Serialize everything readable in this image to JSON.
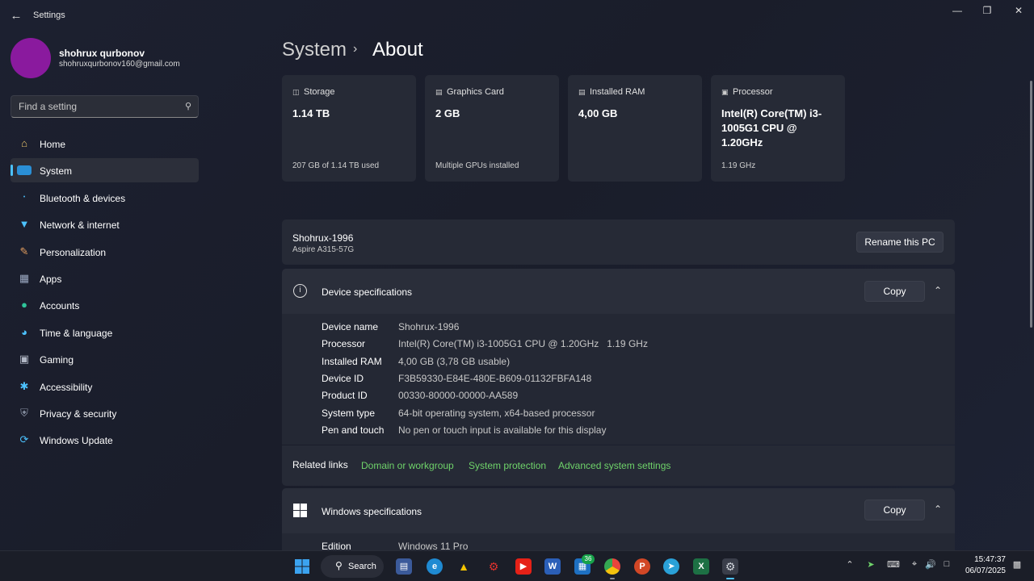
{
  "window": {
    "title": "Settings",
    "minimize": "—",
    "maximize": "❐",
    "close": "✕"
  },
  "user": {
    "name": "shohrux qurbonov",
    "email": "shohruxqurbonov160@gmail.com"
  },
  "search": {
    "placeholder": "Find a setting"
  },
  "nav": [
    {
      "label": "Home",
      "icon": "home-icon",
      "active": false
    },
    {
      "label": "System",
      "icon": "system-icon",
      "active": true
    },
    {
      "label": "Bluetooth & devices",
      "icon": "bluetooth-icon",
      "active": false
    },
    {
      "label": "Network & internet",
      "icon": "wifi-icon",
      "active": false
    },
    {
      "label": "Personalization",
      "icon": "brush-icon",
      "active": false
    },
    {
      "label": "Apps",
      "icon": "apps-icon",
      "active": false
    },
    {
      "label": "Accounts",
      "icon": "accounts-icon",
      "active": false
    },
    {
      "label": "Time & language",
      "icon": "globe-icon",
      "active": false
    },
    {
      "label": "Gaming",
      "icon": "gamepad-icon",
      "active": false
    },
    {
      "label": "Accessibility",
      "icon": "accessibility-icon",
      "active": false
    },
    {
      "label": "Privacy & security",
      "icon": "shield-icon",
      "active": false
    },
    {
      "label": "Windows Update",
      "icon": "update-icon",
      "active": false
    }
  ],
  "breadcrumb": {
    "parent": "System",
    "separator": "›",
    "current": "About"
  },
  "cards": [
    {
      "title": "Storage",
      "value": "1.14 TB",
      "sub": "207 GB of 1.14 TB used",
      "icon": "storage-icon"
    },
    {
      "title": "Graphics Card",
      "value": "2 GB",
      "sub": "Multiple GPUs installed",
      "icon": "gpu-icon"
    },
    {
      "title": "Installed RAM",
      "value": "4,00 GB",
      "sub": "",
      "icon": "ram-icon"
    },
    {
      "title": "Processor",
      "value": "Intel(R) Core(TM) i3-1005G1 CPU @ 1.20GHz",
      "sub": "1.19 GHz",
      "icon": "cpu-icon"
    }
  ],
  "pc": {
    "name": "Shohrux-1996",
    "model": "Aspire A315-57G",
    "rename_label": "Rename this PC"
  },
  "device_specs": {
    "title": "Device specifications",
    "copy_label": "Copy",
    "rows": [
      {
        "key": "Device name",
        "value": "Shohrux-1996"
      },
      {
        "key": "Processor",
        "value": "Intel(R) Core(TM) i3-1005G1 CPU @ 1.20GHz   1.19 GHz"
      },
      {
        "key": "Installed RAM",
        "value": "4,00 GB (3,78 GB usable)"
      },
      {
        "key": "Device ID",
        "value": "F3B59330-E84E-480E-B609-01132FBFA148"
      },
      {
        "key": "Product ID",
        "value": "00330-80000-00000-AA589"
      },
      {
        "key": "System type",
        "value": "64-bit operating system, x64-based processor"
      },
      {
        "key": "Pen and touch",
        "value": "No pen or touch input is available for this display"
      }
    ]
  },
  "related_links": {
    "label": "Related links",
    "links": [
      "Domain or workgroup",
      "System protection",
      "Advanced system settings"
    ]
  },
  "windows_specs": {
    "title": "Windows specifications",
    "copy_label": "Copy",
    "rows": [
      {
        "key": "Edition",
        "value": "Windows 11 Pro"
      }
    ]
  },
  "taskbar": {
    "search_label": "Search",
    "badge_count": "36",
    "time": "15:47:37",
    "date": "06/07/2025"
  },
  "colors": {
    "accent": "#4cc2ff",
    "link": "#6fd36a",
    "avatar": "#8a1a9e"
  }
}
